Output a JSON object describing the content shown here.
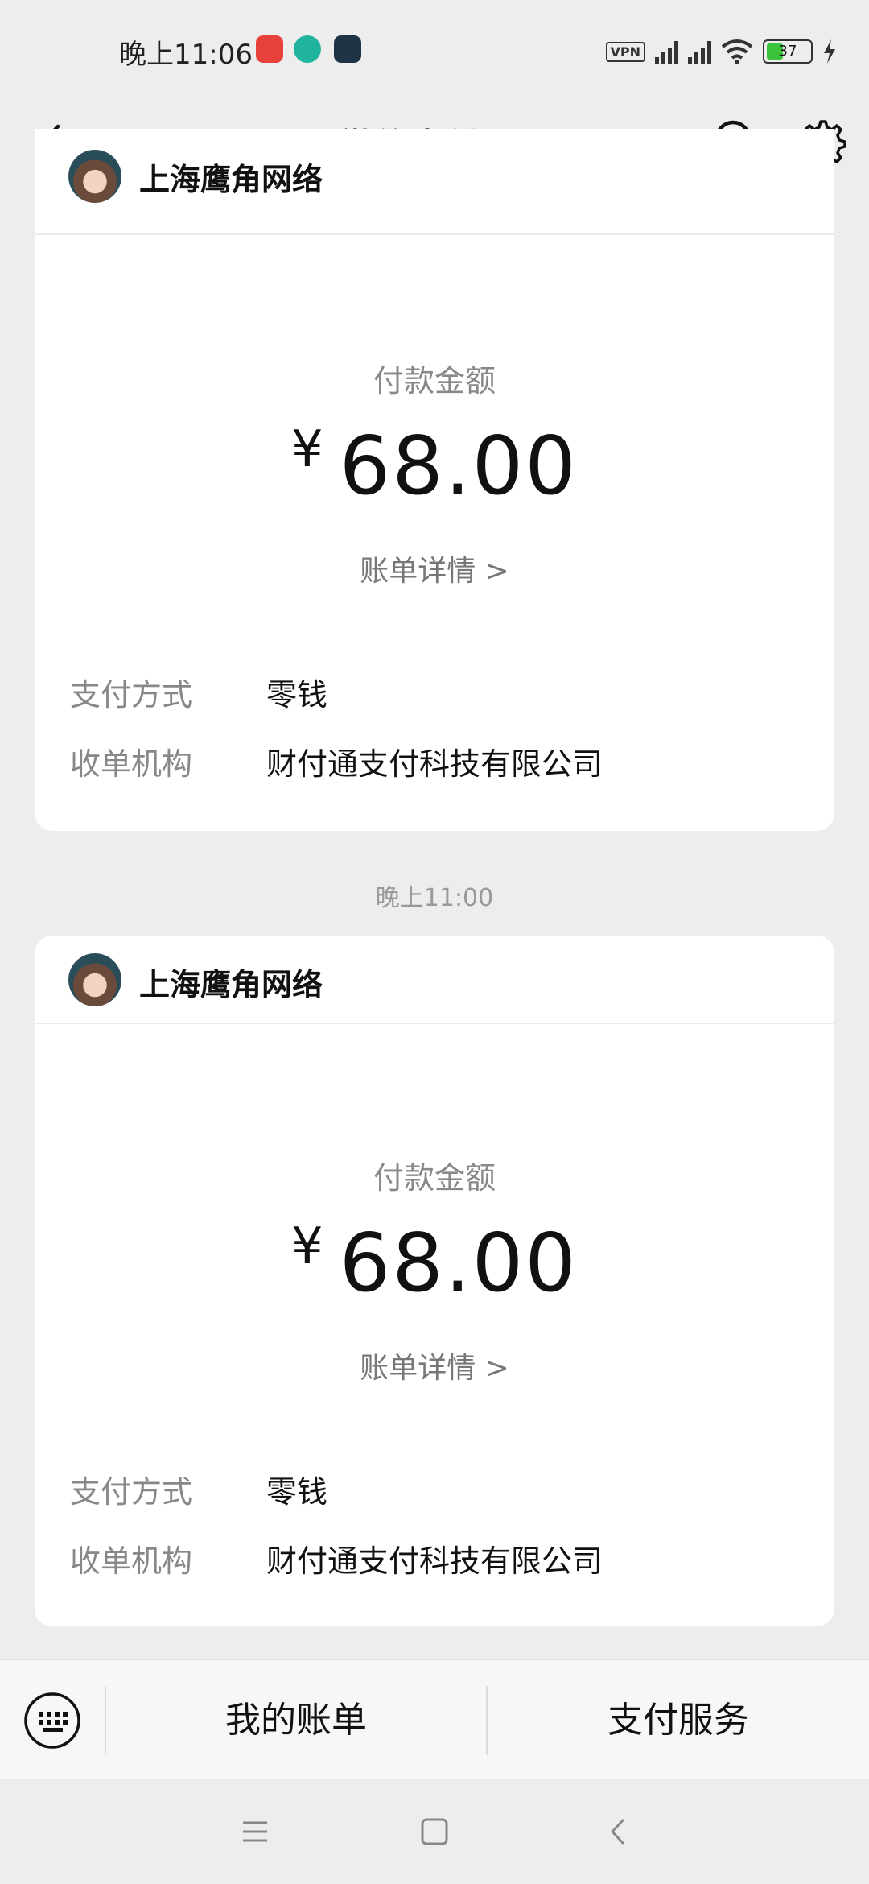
{
  "status_bar": {
    "time": "晚上11:06",
    "vpn": "VPN",
    "battery": "37",
    "battery_color": "#3cc33c"
  },
  "header": {
    "title": "微信支付",
    "icons": [
      "back-icon",
      "bell-muted-icon",
      "search-icon",
      "gear-icon"
    ]
  },
  "payments": [
    {
      "merchant": "上海鹰角网络",
      "amount_label": "付款金额",
      "currency": "¥",
      "amount": "68.00",
      "detail_link": "账单详情 >",
      "method_label": "支付方式",
      "method_value": "零钱",
      "institution_label": "收单机构",
      "institution_value": "财付通支付科技有限公司"
    },
    {
      "merchant": "上海鹰角网络",
      "amount_label": "付款金额",
      "currency": "¥",
      "amount": "68.00",
      "detail_link": "账单详情 >",
      "method_label": "支付方式",
      "method_value": "零钱",
      "institution_label": "收单机构",
      "institution_value": "财付通支付科技有限公司"
    }
  ],
  "timestamp": "晚上11:00",
  "bottom_menu": {
    "my_bills": "我的账单",
    "payment_services": "支付服务"
  },
  "nav_bar": {
    "icons": [
      "menu-icon",
      "home-icon",
      "back-icon"
    ]
  }
}
